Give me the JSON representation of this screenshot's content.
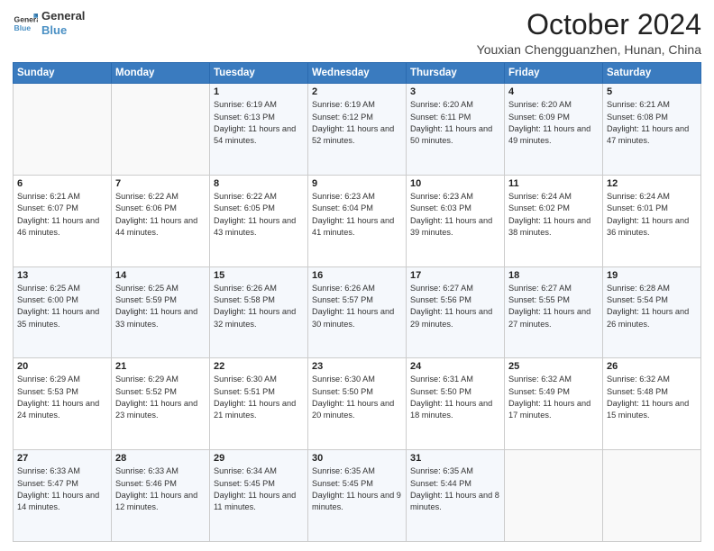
{
  "logo": {
    "line1": "General",
    "line2": "Blue"
  },
  "title": "October 2024",
  "location": "Youxian Chengguanzhen, Hunan, China",
  "days_of_week": [
    "Sunday",
    "Monday",
    "Tuesday",
    "Wednesday",
    "Thursday",
    "Friday",
    "Saturday"
  ],
  "weeks": [
    [
      {
        "day": null,
        "sunrise": null,
        "sunset": null,
        "daylight": null
      },
      {
        "day": null,
        "sunrise": null,
        "sunset": null,
        "daylight": null
      },
      {
        "day": "1",
        "sunrise": "Sunrise: 6:19 AM",
        "sunset": "Sunset: 6:13 PM",
        "daylight": "Daylight: 11 hours and 54 minutes."
      },
      {
        "day": "2",
        "sunrise": "Sunrise: 6:19 AM",
        "sunset": "Sunset: 6:12 PM",
        "daylight": "Daylight: 11 hours and 52 minutes."
      },
      {
        "day": "3",
        "sunrise": "Sunrise: 6:20 AM",
        "sunset": "Sunset: 6:11 PM",
        "daylight": "Daylight: 11 hours and 50 minutes."
      },
      {
        "day": "4",
        "sunrise": "Sunrise: 6:20 AM",
        "sunset": "Sunset: 6:09 PM",
        "daylight": "Daylight: 11 hours and 49 minutes."
      },
      {
        "day": "5",
        "sunrise": "Sunrise: 6:21 AM",
        "sunset": "Sunset: 6:08 PM",
        "daylight": "Daylight: 11 hours and 47 minutes."
      }
    ],
    [
      {
        "day": "6",
        "sunrise": "Sunrise: 6:21 AM",
        "sunset": "Sunset: 6:07 PM",
        "daylight": "Daylight: 11 hours and 46 minutes."
      },
      {
        "day": "7",
        "sunrise": "Sunrise: 6:22 AM",
        "sunset": "Sunset: 6:06 PM",
        "daylight": "Daylight: 11 hours and 44 minutes."
      },
      {
        "day": "8",
        "sunrise": "Sunrise: 6:22 AM",
        "sunset": "Sunset: 6:05 PM",
        "daylight": "Daylight: 11 hours and 43 minutes."
      },
      {
        "day": "9",
        "sunrise": "Sunrise: 6:23 AM",
        "sunset": "Sunset: 6:04 PM",
        "daylight": "Daylight: 11 hours and 41 minutes."
      },
      {
        "day": "10",
        "sunrise": "Sunrise: 6:23 AM",
        "sunset": "Sunset: 6:03 PM",
        "daylight": "Daylight: 11 hours and 39 minutes."
      },
      {
        "day": "11",
        "sunrise": "Sunrise: 6:24 AM",
        "sunset": "Sunset: 6:02 PM",
        "daylight": "Daylight: 11 hours and 38 minutes."
      },
      {
        "day": "12",
        "sunrise": "Sunrise: 6:24 AM",
        "sunset": "Sunset: 6:01 PM",
        "daylight": "Daylight: 11 hours and 36 minutes."
      }
    ],
    [
      {
        "day": "13",
        "sunrise": "Sunrise: 6:25 AM",
        "sunset": "Sunset: 6:00 PM",
        "daylight": "Daylight: 11 hours and 35 minutes."
      },
      {
        "day": "14",
        "sunrise": "Sunrise: 6:25 AM",
        "sunset": "Sunset: 5:59 PM",
        "daylight": "Daylight: 11 hours and 33 minutes."
      },
      {
        "day": "15",
        "sunrise": "Sunrise: 6:26 AM",
        "sunset": "Sunset: 5:58 PM",
        "daylight": "Daylight: 11 hours and 32 minutes."
      },
      {
        "day": "16",
        "sunrise": "Sunrise: 6:26 AM",
        "sunset": "Sunset: 5:57 PM",
        "daylight": "Daylight: 11 hours and 30 minutes."
      },
      {
        "day": "17",
        "sunrise": "Sunrise: 6:27 AM",
        "sunset": "Sunset: 5:56 PM",
        "daylight": "Daylight: 11 hours and 29 minutes."
      },
      {
        "day": "18",
        "sunrise": "Sunrise: 6:27 AM",
        "sunset": "Sunset: 5:55 PM",
        "daylight": "Daylight: 11 hours and 27 minutes."
      },
      {
        "day": "19",
        "sunrise": "Sunrise: 6:28 AM",
        "sunset": "Sunset: 5:54 PM",
        "daylight": "Daylight: 11 hours and 26 minutes."
      }
    ],
    [
      {
        "day": "20",
        "sunrise": "Sunrise: 6:29 AM",
        "sunset": "Sunset: 5:53 PM",
        "daylight": "Daylight: 11 hours and 24 minutes."
      },
      {
        "day": "21",
        "sunrise": "Sunrise: 6:29 AM",
        "sunset": "Sunset: 5:52 PM",
        "daylight": "Daylight: 11 hours and 23 minutes."
      },
      {
        "day": "22",
        "sunrise": "Sunrise: 6:30 AM",
        "sunset": "Sunset: 5:51 PM",
        "daylight": "Daylight: 11 hours and 21 minutes."
      },
      {
        "day": "23",
        "sunrise": "Sunrise: 6:30 AM",
        "sunset": "Sunset: 5:50 PM",
        "daylight": "Daylight: 11 hours and 20 minutes."
      },
      {
        "day": "24",
        "sunrise": "Sunrise: 6:31 AM",
        "sunset": "Sunset: 5:50 PM",
        "daylight": "Daylight: 11 hours and 18 minutes."
      },
      {
        "day": "25",
        "sunrise": "Sunrise: 6:32 AM",
        "sunset": "Sunset: 5:49 PM",
        "daylight": "Daylight: 11 hours and 17 minutes."
      },
      {
        "day": "26",
        "sunrise": "Sunrise: 6:32 AM",
        "sunset": "Sunset: 5:48 PM",
        "daylight": "Daylight: 11 hours and 15 minutes."
      }
    ],
    [
      {
        "day": "27",
        "sunrise": "Sunrise: 6:33 AM",
        "sunset": "Sunset: 5:47 PM",
        "daylight": "Daylight: 11 hours and 14 minutes."
      },
      {
        "day": "28",
        "sunrise": "Sunrise: 6:33 AM",
        "sunset": "Sunset: 5:46 PM",
        "daylight": "Daylight: 11 hours and 12 minutes."
      },
      {
        "day": "29",
        "sunrise": "Sunrise: 6:34 AM",
        "sunset": "Sunset: 5:45 PM",
        "daylight": "Daylight: 11 hours and 11 minutes."
      },
      {
        "day": "30",
        "sunrise": "Sunrise: 6:35 AM",
        "sunset": "Sunset: 5:45 PM",
        "daylight": "Daylight: 11 hours and 9 minutes."
      },
      {
        "day": "31",
        "sunrise": "Sunrise: 6:35 AM",
        "sunset": "Sunset: 5:44 PM",
        "daylight": "Daylight: 11 hours and 8 minutes."
      },
      {
        "day": null,
        "sunrise": null,
        "sunset": null,
        "daylight": null
      },
      {
        "day": null,
        "sunrise": null,
        "sunset": null,
        "daylight": null
      }
    ]
  ]
}
